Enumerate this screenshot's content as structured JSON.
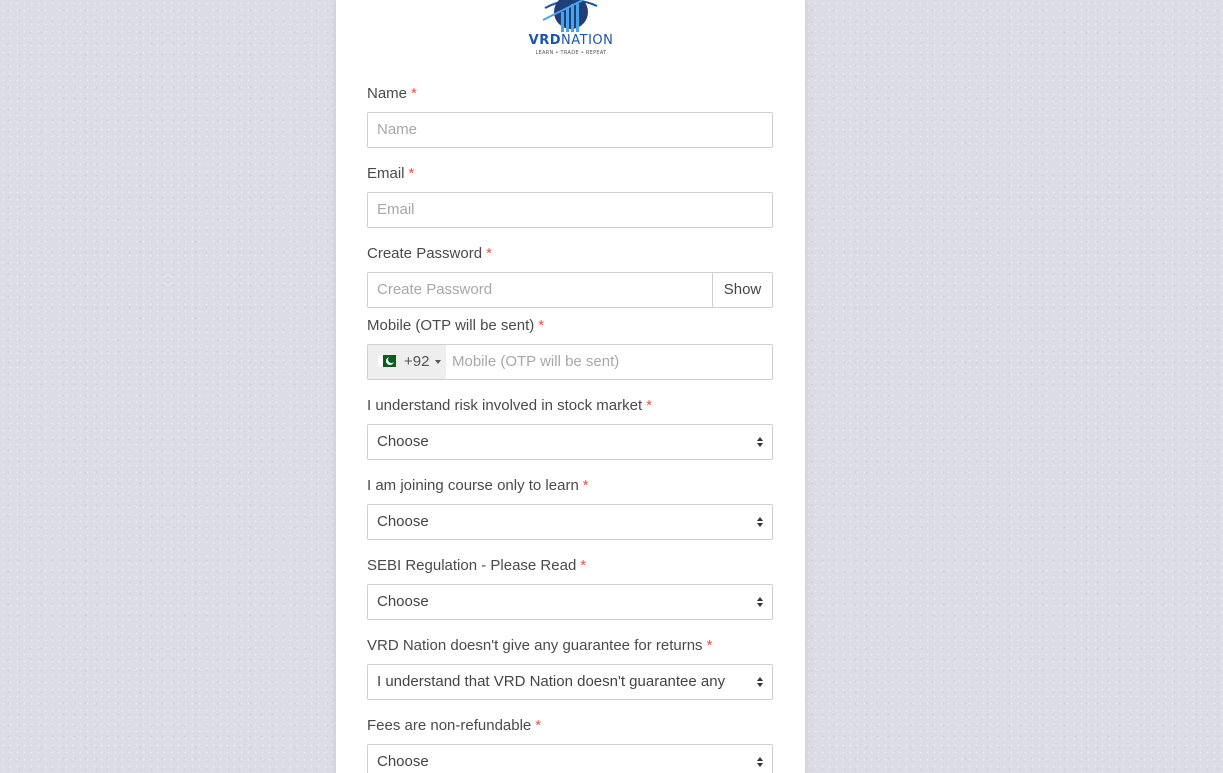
{
  "logo": {
    "brand_bold": "VRD",
    "brand_rest": "NATION",
    "tagline": "LEARN • TRADE • REPEAT"
  },
  "form": {
    "required_mark": "*",
    "name": {
      "label": "Name",
      "placeholder": "Name"
    },
    "email": {
      "label": "Email",
      "placeholder": "Email"
    },
    "password": {
      "label": "Create Password",
      "placeholder": "Create Password",
      "toggle_label": "Show"
    },
    "mobile": {
      "label": "Mobile (OTP will be sent)",
      "dial_code": "+92",
      "placeholder": "Mobile (OTP will be sent)",
      "country_flag": "pakistan-flag-icon"
    },
    "risk": {
      "label": "I understand risk involved in stock market",
      "value": "Choose"
    },
    "learn": {
      "label": "I am joining course only to learn",
      "value": "Choose"
    },
    "sebi": {
      "label": "SEBI Regulation - Please Read",
      "value": "Choose"
    },
    "guarantee": {
      "label": "VRD Nation doesn't give any guarantee for returns",
      "value": "I understand that VRD Nation doesn't guarantee any"
    },
    "fees": {
      "label": "Fees are non-refundable",
      "value": "Choose"
    }
  },
  "colors": {
    "brand_blue": "#1b56a8",
    "required_red": "#e0543c",
    "page_background": "#dcdce6"
  }
}
